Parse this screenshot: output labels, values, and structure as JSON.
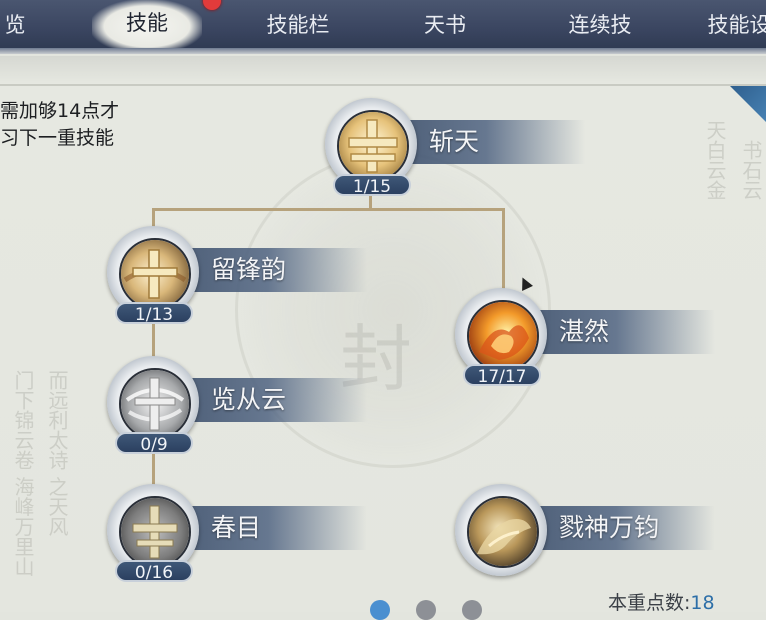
{
  "tabs": [
    {
      "label": "览"
    },
    {
      "label": "技能"
    },
    {
      "label": "技能栏"
    },
    {
      "label": "天书"
    },
    {
      "label": "连续技"
    },
    {
      "label": "技能设"
    }
  ],
  "hint": {
    "line1": "需加够14点才",
    "line2": "习下一重技能"
  },
  "skills": [
    {
      "name": "斩天",
      "level": "1/15"
    },
    {
      "name": "留锋韵",
      "level": "1/13"
    },
    {
      "name": "湛然",
      "level": "17/17"
    },
    {
      "name": "览从云",
      "level": "0/9"
    },
    {
      "name": "春目",
      "level": "0/16"
    },
    {
      "name": "戮神万钧",
      "level": ""
    }
  ],
  "footer": {
    "points_label": "本重点数:",
    "points_value": "18"
  },
  "colors": {
    "accent": "#2d6fa8",
    "ribbon": "#3c4e69",
    "tab_bar": "#3a4560",
    "notification": "#e23b3b"
  },
  "icons": [
    "cross-sword-icon",
    "flame-fist-icon",
    "whirlwind-icon",
    "golden-strike-icon"
  ]
}
